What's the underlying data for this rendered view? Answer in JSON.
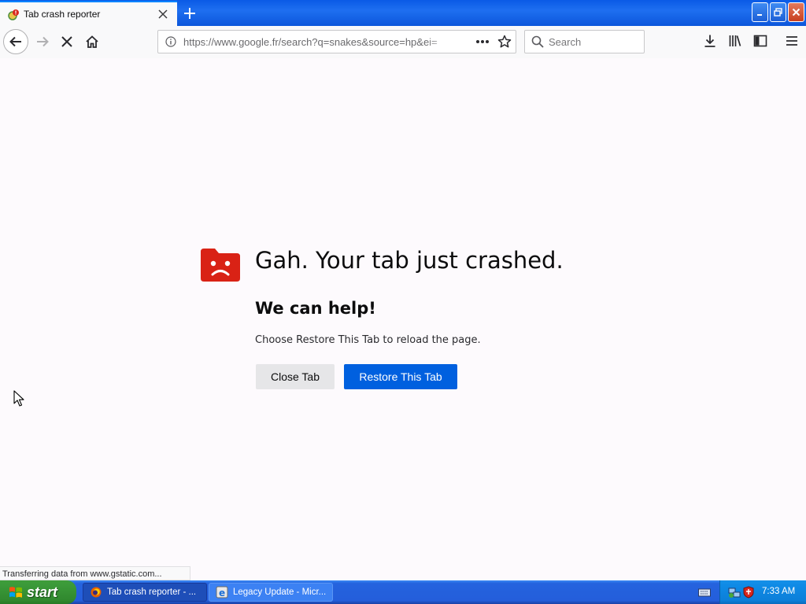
{
  "browser": {
    "tab": {
      "title": "Tab crash reporter"
    },
    "url": "https://www.google.fr/search?q=snakes&source=hp&ei=",
    "search_placeholder": "Search"
  },
  "crash_page": {
    "title": "Gah. Your tab just crashed.",
    "subtitle": "We can help!",
    "message": "Choose Restore This Tab to reload the page.",
    "close_button": "Close Tab",
    "restore_button": "Restore This Tab",
    "icon_color": "#d92215"
  },
  "status": {
    "text": "Transferring data from www.gstatic.com..."
  },
  "taskbar": {
    "start_label": "start",
    "tasks": [
      {
        "label": "Tab crash reporter - ...",
        "icon": "firefox-icon"
      },
      {
        "label": "Legacy Update - Micr...",
        "icon": "internet-explorer-icon"
      }
    ],
    "clock": "7:33 AM"
  },
  "colors": {
    "accent_blue": "#0060df",
    "xp_taskbar": "#245edb",
    "xp_start_green": "#3c9b3a"
  }
}
